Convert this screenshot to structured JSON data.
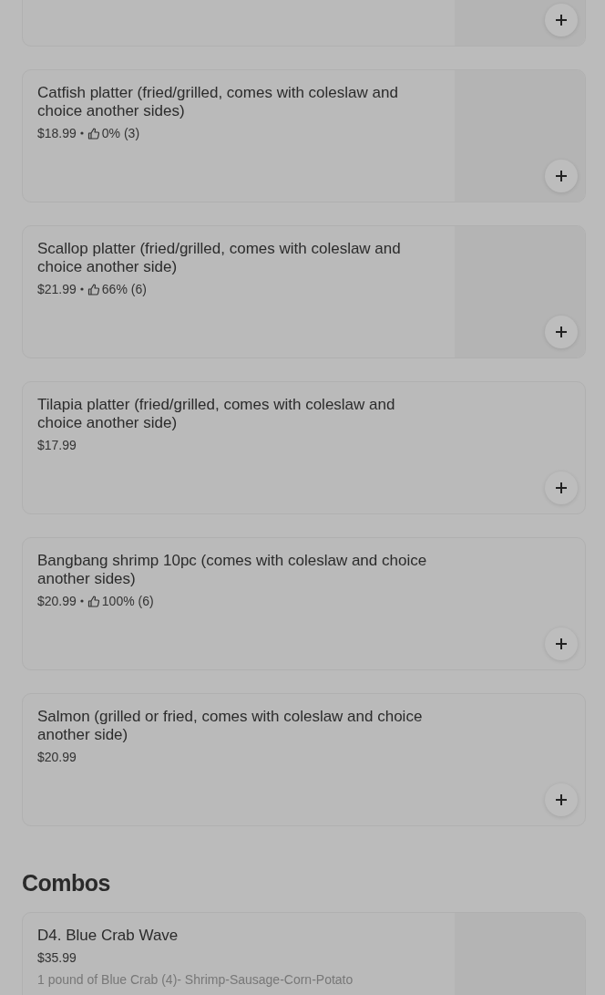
{
  "sections": [
    {
      "items": [
        {
          "add_button": true
        },
        {
          "name": "Catfish platter (fried/grilled, comes with coleslaw and choice another sides)",
          "price": "$18.99",
          "rating": "0% (3)",
          "add_button": true
        },
        {
          "name": "Scallop platter (fried/grilled, comes with coleslaw and choice another side)",
          "price": "$21.99",
          "rating": "66% (6)",
          "add_button": true
        },
        {
          "name": "Tilapia platter (fried/grilled, comes with coleslaw and choice another side)",
          "price": "$17.99",
          "add_button": true
        },
        {
          "name": "Bangbang shrimp 10pc (comes with coleslaw and choice another sides)",
          "price": "$20.99",
          "rating": "100% (6)",
          "add_button": true
        },
        {
          "name": "Salmon (grilled or fried, comes with coleslaw and choice another side)",
          "price": "$20.99",
          "add_button": true
        }
      ]
    },
    {
      "title": "Combos",
      "items": [
        {
          "name": "D4. Blue Crab Wave",
          "price": "$35.99",
          "description": "1 pound of Blue Crab (4)- Shrimp-Sausage-Corn-Potato"
        }
      ]
    }
  ]
}
